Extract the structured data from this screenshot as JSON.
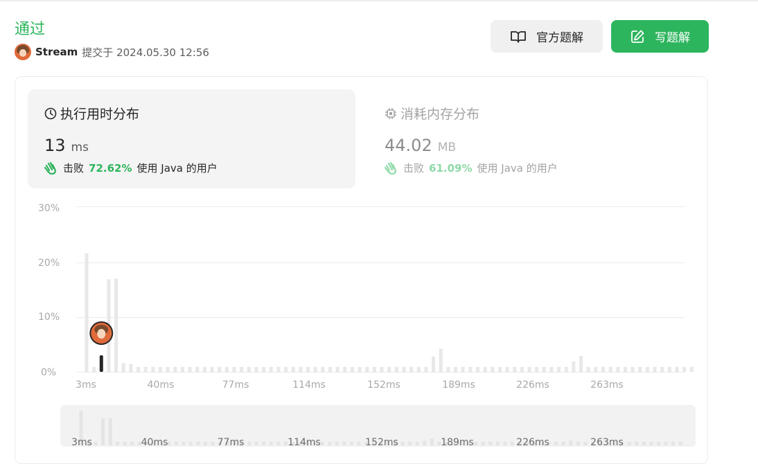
{
  "submission": {
    "status": "通过",
    "username": "Stream",
    "submitted_text": "提交于 2024.05.30 12:56"
  },
  "buttons": {
    "official_solution": "官方题解",
    "write_solution": "写题解"
  },
  "runtime": {
    "title": "执行用时分布",
    "value": "13",
    "unit": "ms",
    "beats_prefix": "击败",
    "beats_pct": "72.62%",
    "beats_suffix": "使用 Java 的用户"
  },
  "memory": {
    "title": "消耗内存分布",
    "value": "44.02",
    "unit": "MB",
    "beats_prefix": "击败",
    "beats_pct": "61.09%",
    "beats_suffix": "使用 Java 的用户"
  },
  "colors": {
    "accent_green": "#2db55d",
    "bar_gray": "#e8e8e8",
    "selected_bar": "#262626"
  },
  "chart_data": {
    "type": "bar",
    "title": "",
    "xlabel": "",
    "ylabel": "",
    "y_ticks": [
      "0%",
      "10%",
      "20%",
      "30%"
    ],
    "ylim": [
      0,
      30
    ],
    "x_ticks": [
      "3ms",
      "40ms",
      "77ms",
      "114ms",
      "152ms",
      "189ms",
      "226ms",
      "263ms"
    ],
    "x_start": 3,
    "x_step": 3.7,
    "values": [
      21.5,
      0.9,
      1.5,
      16.8,
      16.9,
      1.6,
      1.4,
      0.9,
      0.9,
      0.9,
      0.9,
      0.9,
      0.9,
      0.9,
      0.9,
      0.9,
      0.9,
      0.9,
      0.9,
      0.9,
      0.9,
      0.9,
      0.9,
      0.9,
      0.9,
      0.9,
      0.9,
      0.9,
      0.9,
      0.9,
      0.9,
      0.9,
      0.9,
      0.9,
      0.9,
      0.9,
      0.9,
      0.9,
      0.9,
      0.9,
      0.9,
      0.9,
      0.9,
      0.9,
      0.9,
      0.9,
      0.9,
      2.8,
      4.2,
      0.9,
      0.9,
      0.9,
      0.9,
      0.9,
      0.9,
      0.9,
      0.9,
      0.9,
      0.9,
      0.9,
      0.9,
      0.9,
      0.9,
      0.9,
      0.9,
      0.9,
      1.9,
      2.9,
      0.9,
      0.9,
      0.9,
      0.9,
      0.9,
      0.9,
      0.9,
      0.9,
      0.9,
      0.9,
      0.9,
      0.9,
      0.9,
      0.9,
      0.9
    ],
    "selected_index": 2,
    "selected_label": "13ms",
    "grid": true,
    "legend": "none"
  },
  "mini_chart": {
    "x_ticks": [
      "3ms",
      "40ms",
      "77ms",
      "114ms",
      "152ms",
      "189ms",
      "226ms",
      "263ms"
    ]
  }
}
